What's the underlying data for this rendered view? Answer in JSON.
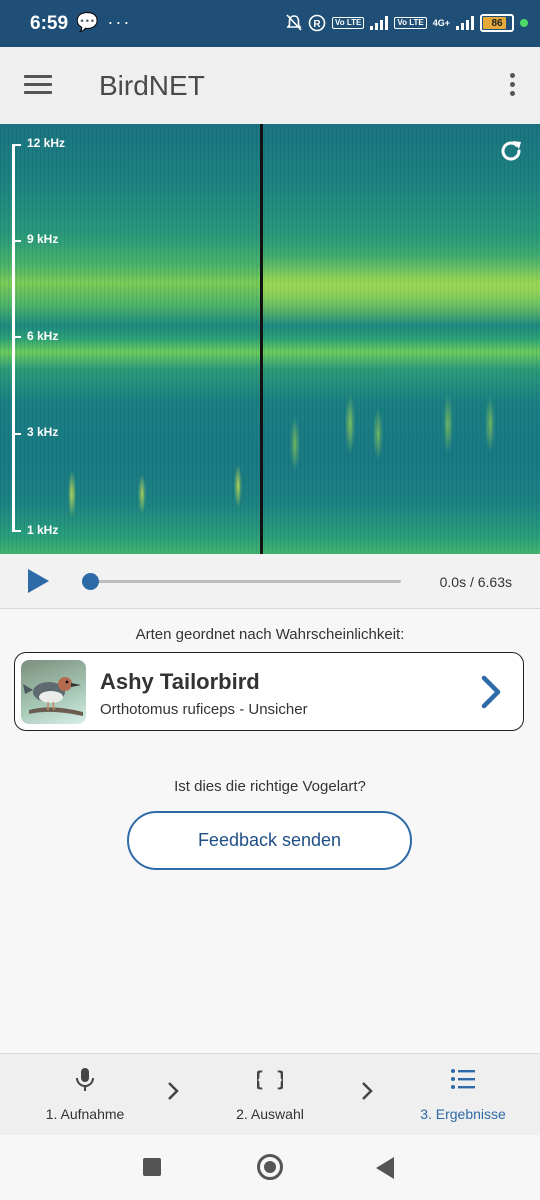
{
  "status_bar": {
    "time": "6:59",
    "left_icons": "💬 ···",
    "battery_level": "86",
    "network_label": "4G+",
    "lte_label": "Vo LTE"
  },
  "app_bar": {
    "title": "BirdNET",
    "menu_icon": "hamburger-menu-icon",
    "more_icon": "more-vertical-icon"
  },
  "spectrogram": {
    "axis_labels": [
      "12 kHz",
      "9 kHz",
      "6 kHz",
      "3 kHz",
      "1 kHz"
    ],
    "refresh_icon": "refresh-icon"
  },
  "player": {
    "time_readout": "0.0s / 6.63s",
    "progress": 0.0
  },
  "results": {
    "heading": "Arten geordnet nach Wahrscheinlichkeit:",
    "items": [
      {
        "common_name": "Ashy Tailorbird",
        "scientific_line": "Orthotomus ruficeps - Unsicher"
      }
    ],
    "question": "Ist dies die richtige Vogelart?",
    "feedback_button": "Feedback senden"
  },
  "bottom_nav": {
    "items": [
      {
        "label": "1. Aufnahme",
        "icon": "microphone-icon"
      },
      {
        "label": "2. Auswahl",
        "icon": "braces-icon"
      },
      {
        "label": "3. Ergebnisse",
        "icon": "list-icon"
      }
    ],
    "active_index": 2
  },
  "colors": {
    "status_bar": "#1f4f76",
    "accent": "#2e6aa8",
    "battery": "#e6a93a"
  }
}
